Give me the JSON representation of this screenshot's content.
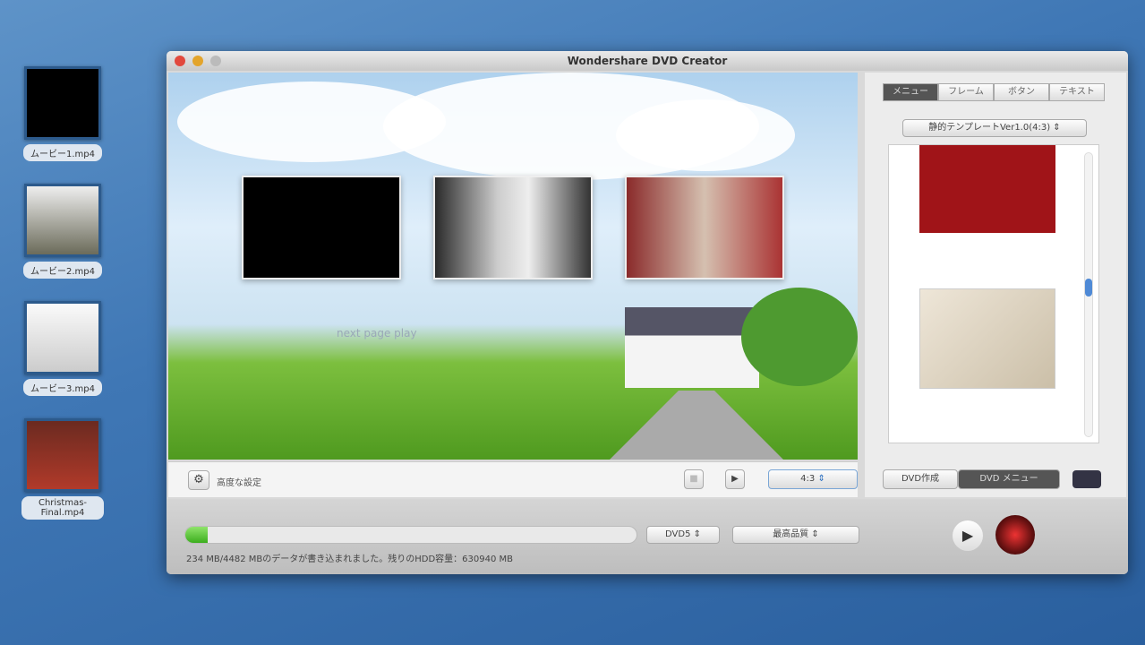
{
  "desktop": {
    "icons": [
      {
        "label": "ムービー1.mp4"
      },
      {
        "label": "ムービー2.mp4"
      },
      {
        "label": "ムービー3.mp4"
      },
      {
        "label": "Christmas-Final.mp4"
      }
    ]
  },
  "window": {
    "title": "Wondershare DVD Creator"
  },
  "preview": {
    "nav_text": "next page  play"
  },
  "controls": {
    "advanced_label": "高度な設定",
    "aspect": "4:3"
  },
  "side": {
    "tabs": [
      "メニュー",
      "フレーム",
      "ボタン",
      "テキスト"
    ],
    "active_tab": 0,
    "template_select": "静的テンプレートVer1.0(4:3)"
  },
  "mode": {
    "create": "DVD作成",
    "menu": "DVD メニュー"
  },
  "bottom": {
    "disc": "DVD5",
    "quality": "最高品質",
    "progress_percent": 5,
    "status": "234 MB/4482 MBのデータが書き込まれました。残りのHDD容量：630940 MB"
  },
  "colors": {
    "accent": "#3cae1e",
    "template_red": "#a01418"
  }
}
